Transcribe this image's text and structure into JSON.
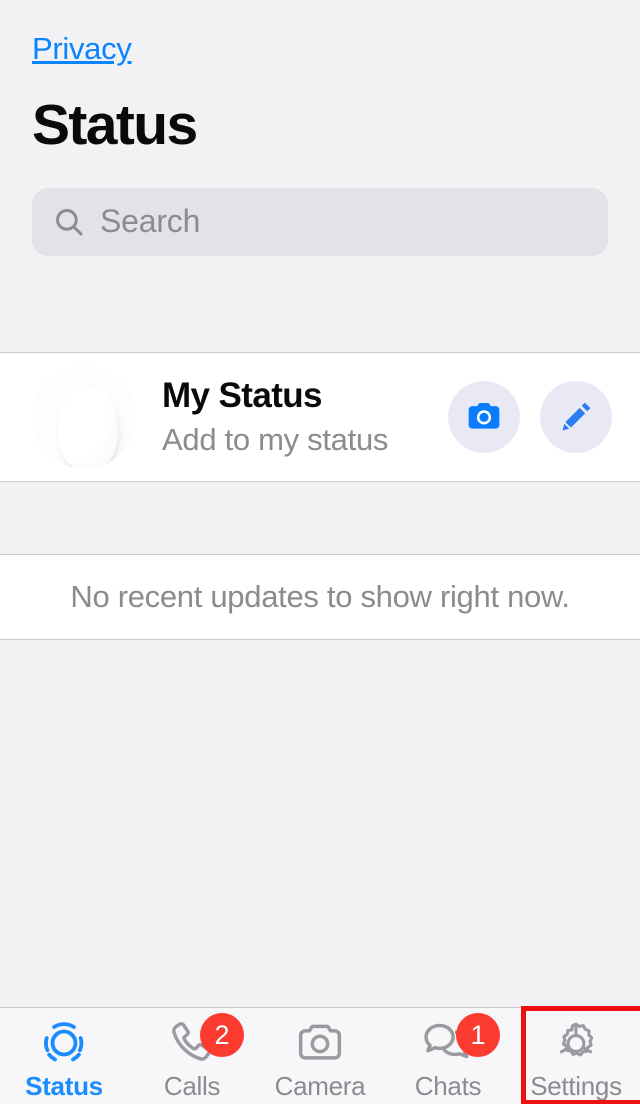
{
  "header": {
    "back_label": "Privacy",
    "title": "Status"
  },
  "search": {
    "placeholder": "Search",
    "value": "",
    "icon": "search-icon"
  },
  "my_status": {
    "title": "My Status",
    "subtitle": "Add to my status",
    "avatar": "default-avatar-icon",
    "camera_button": "camera-icon",
    "edit_button": "pencil-icon"
  },
  "empty_state": {
    "text": "No recent updates to show right now."
  },
  "tab_bar": {
    "tabs": [
      {
        "label": "Status",
        "icon": "status-rings-icon",
        "active": true,
        "badge": ""
      },
      {
        "label": "Calls",
        "icon": "phone-icon",
        "active": false,
        "badge": "2"
      },
      {
        "label": "Camera",
        "icon": "camera-icon",
        "active": false,
        "badge": ""
      },
      {
        "label": "Chats",
        "icon": "chat-bubbles-icon",
        "active": false,
        "badge": "1"
      },
      {
        "label": "Settings",
        "icon": "gear-icon",
        "active": false,
        "badge": ""
      }
    ]
  },
  "annotation": {
    "target": "Settings",
    "color": "#ee1111"
  },
  "colors": {
    "accent_blue": "#0a84ff",
    "active_tab": "#1a8cff",
    "badge_red": "#fb3b30",
    "background": "#f2f1f4",
    "card": "#ffffff",
    "secondary_text": "#8b8b90"
  }
}
